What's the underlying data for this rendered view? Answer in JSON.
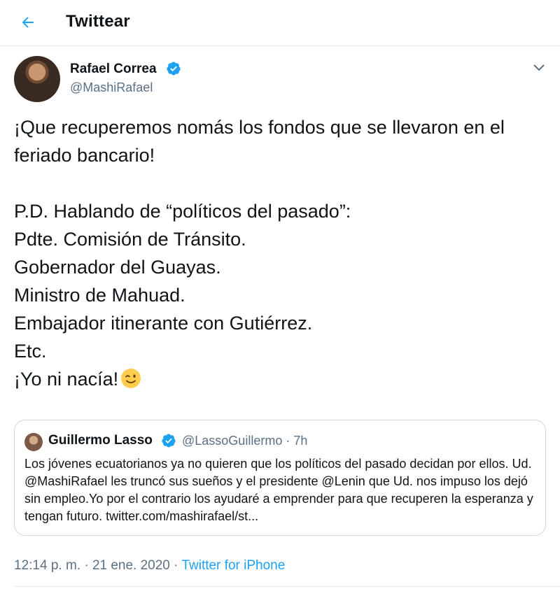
{
  "header": {
    "back_icon": "back-arrow-icon",
    "title": "Twittear"
  },
  "tweet": {
    "author_name": "Rafael Correa",
    "author_handle": "@MashiRafael",
    "verified": true,
    "text": "¡Que recuperemos nomás los fondos que se llevaron en el feriado bancario!\n\nP.D. Hablando de “políticos del pasado”:\nPdte. Comisión de Tránsito.\nGobernador del Guayas.\nMinistro de Mahuad.\nEmbajador itinerante con Gutiérrez.\nEtc.\n¡Yo ni nacía!",
    "emoji": "winking-face-emoji",
    "timestamp": "12:14 p. m. · 21 ene. 2020",
    "separator": " · ",
    "source": "Twitter for iPhone"
  },
  "quoted": {
    "author_name": "Guillermo Lasso",
    "author_handle": "@LassoGuillermo",
    "time": "· 7h",
    "text": "Los jóvenes ecuatorianos ya no quieren que los políticos del pasado decidan por ellos. Ud. @MashiRafael les truncó sus sueños y el presidente @Lenin que Ud. nos impuso los dejó sin empleo.Yo por el contrario los ayudaré a emprender para que recuperen la esperanza y tengan futuro. twitter.com/mashirafael/st..."
  },
  "colors": {
    "accent": "#1da1f2",
    "secondary_text": "#5b7083",
    "border": "#ccd6dd"
  }
}
